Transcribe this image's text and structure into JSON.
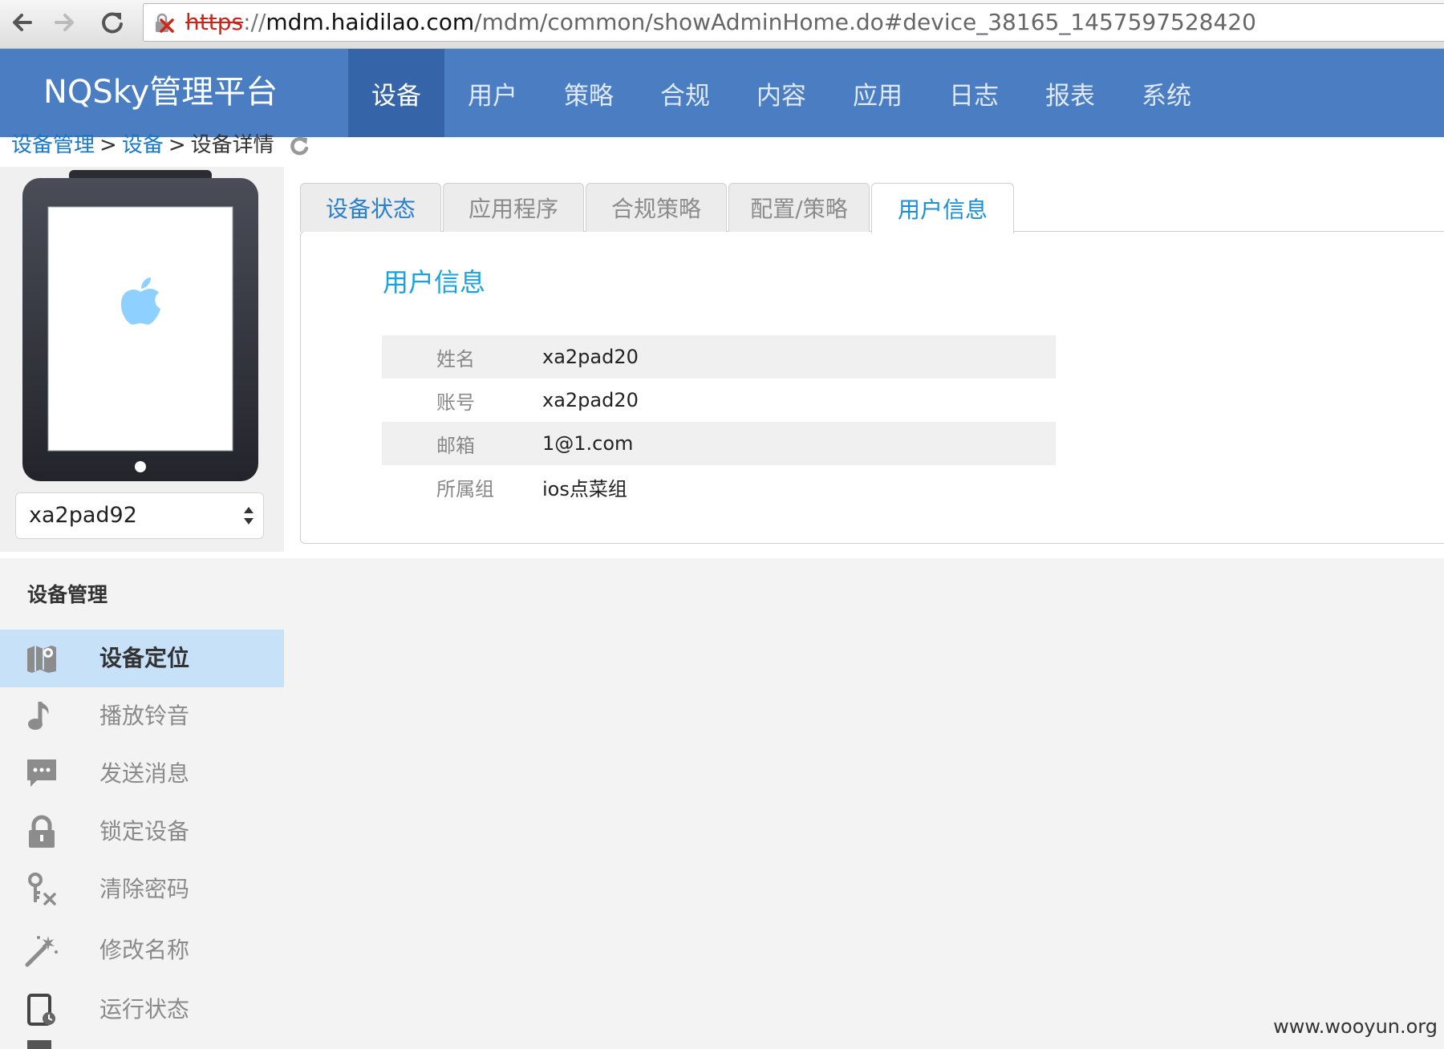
{
  "browser": {
    "url_scheme": "https",
    "url_sep": "://",
    "url_host": "mdm.haidilao.com",
    "url_path": "/mdm/common/showAdminHome.do#device_38165_1457597528420"
  },
  "header": {
    "brand": "NQSky管理平台",
    "nav": [
      "设备",
      "用户",
      "策略",
      "合规",
      "内容",
      "应用",
      "日志",
      "报表",
      "系统"
    ],
    "active_nav": "设备"
  },
  "breadcrumb": {
    "items": [
      "设备管理",
      "设备",
      "设备详情"
    ],
    "separator": ">"
  },
  "device": {
    "selected": "xa2pad92"
  },
  "sidebar": {
    "title": "设备管理",
    "items": [
      {
        "label": "设备定位",
        "icon": "map-location-icon",
        "active": true
      },
      {
        "label": "播放铃音",
        "icon": "music-note-icon"
      },
      {
        "label": "发送消息",
        "icon": "message-icon"
      },
      {
        "label": "锁定设备",
        "icon": "lock-icon"
      },
      {
        "label": "清除密码",
        "icon": "key-clear-icon"
      },
      {
        "label": "修改名称",
        "icon": "magic-wand-icon"
      },
      {
        "label": "运行状态",
        "icon": "device-status-icon"
      }
    ]
  },
  "tabs": {
    "items": [
      "设备状态",
      "应用程序",
      "合规策略",
      "配置/策略",
      "用户信息"
    ],
    "active": "用户信息"
  },
  "user_info": {
    "title": "用户信息",
    "rows": [
      {
        "key": "姓名",
        "value": "xa2pad20"
      },
      {
        "key": "账号",
        "value": "xa2pad20"
      },
      {
        "key": "邮箱",
        "value": "1@1.com"
      },
      {
        "key": "所属组",
        "value": "ios点菜组"
      }
    ]
  },
  "watermark": "www.wooyun.org",
  "colors": {
    "header_bg": "#4a7dc1",
    "nav_active": "#3564a8",
    "link": "#1777c8",
    "active_side": "#c7e1f9"
  }
}
